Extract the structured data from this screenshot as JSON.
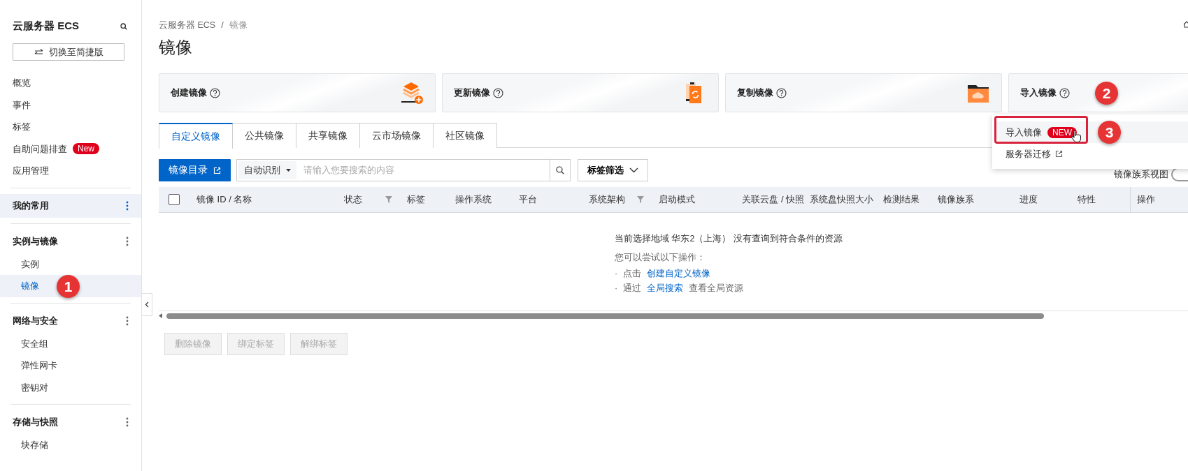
{
  "sidebar": {
    "title": "云服务器 ECS",
    "switch_label": "切换至简捷版",
    "items": [
      {
        "label": "概览",
        "selected": false
      },
      {
        "label": "事件",
        "selected": false
      },
      {
        "label": "标签",
        "selected": false
      },
      {
        "label": "自助问题排查",
        "badge": "New",
        "selected": false
      },
      {
        "label": "应用管理",
        "selected": false
      }
    ],
    "groups": [
      {
        "label": "我的常用",
        "active": true
      },
      {
        "label": "实例与镜像",
        "active": false,
        "children": [
          {
            "label": "实例",
            "selected": false
          },
          {
            "label": "镜像",
            "selected": true,
            "marker": "1"
          }
        ]
      },
      {
        "label": "网络与安全",
        "active": false,
        "children": [
          {
            "label": "安全组",
            "selected": false
          },
          {
            "label": "弹性网卡",
            "selected": false
          },
          {
            "label": "密钥对",
            "selected": false
          }
        ]
      },
      {
        "label": "存储与快照",
        "active": false,
        "children": [
          {
            "label": "块存储",
            "selected": false
          }
        ]
      }
    ]
  },
  "breadcrumb": {
    "items": [
      "云服务器 ECS",
      "镜像"
    ],
    "separator": "/"
  },
  "page_title": "镜像",
  "action_cards": [
    {
      "label": "创建镜像",
      "kind": "create"
    },
    {
      "label": "更新镜像",
      "kind": "update"
    },
    {
      "label": "复制镜像",
      "kind": "copy"
    },
    {
      "label": "导入镜像",
      "kind": "import",
      "marker": "2"
    }
  ],
  "import_menu": {
    "items": [
      {
        "label": "导入镜像",
        "badge": "NEW",
        "external": false,
        "hovered": true,
        "outlined": true,
        "marker": "3"
      },
      {
        "label": "服务器迁移",
        "external": true,
        "hovered": false,
        "outlined": false
      }
    ]
  },
  "tabs": [
    {
      "label": "自定义镜像",
      "selected": true
    },
    {
      "label": "公共镜像",
      "selected": false
    },
    {
      "label": "共享镜像",
      "selected": false
    },
    {
      "label": "云市场镜像",
      "selected": false
    },
    {
      "label": "社区镜像",
      "selected": false
    }
  ],
  "toolbar": {
    "catalog_button": "镜像目录",
    "search_type": "自动识别",
    "search_placeholder": "请输入您要搜索的内容",
    "tag_filter": "标签筛选",
    "view_toggle_label": "镜像族系视图",
    "view_toggle_on": false
  },
  "table": {
    "select_all_checked": false,
    "columns": [
      {
        "label": "镜像 ID / 名称",
        "filter": false
      },
      {
        "label": "状态",
        "filter": true
      },
      {
        "label": "标签",
        "filter": false
      },
      {
        "label": "操作系统",
        "filter": false
      },
      {
        "label": "平台",
        "filter": false
      },
      {
        "label": "系统架构",
        "filter": true
      },
      {
        "label": "启动模式",
        "filter": false
      },
      {
        "label": "关联云盘 / 快照",
        "filter": false
      },
      {
        "label": "系统盘快照大小",
        "filter": false
      },
      {
        "label": "检测结果",
        "filter": false
      },
      {
        "label": "镜像族系",
        "filter": false
      },
      {
        "label": "进度",
        "filter": false
      },
      {
        "label": "特性",
        "filter": false
      },
      {
        "label": "操作",
        "filter": false
      }
    ],
    "empty": {
      "message": "当前选择地域 华东2（上海） 没有查询到符合条件的资源",
      "hint": "您可以尝试以下操作：",
      "suggestions": [
        {
          "bullet": "·",
          "prefix": "点击",
          "link": "创建自定义镜像"
        },
        {
          "bullet": "·",
          "prefix": "通过",
          "link": "全局搜索",
          "suffix": "查看全局资源"
        }
      ]
    }
  },
  "bulk_buttons": [
    {
      "label": "删除镜像",
      "disabled": true
    },
    {
      "label": "绑定标签",
      "disabled": true
    },
    {
      "label": "解绑标签",
      "disabled": true
    }
  ]
}
